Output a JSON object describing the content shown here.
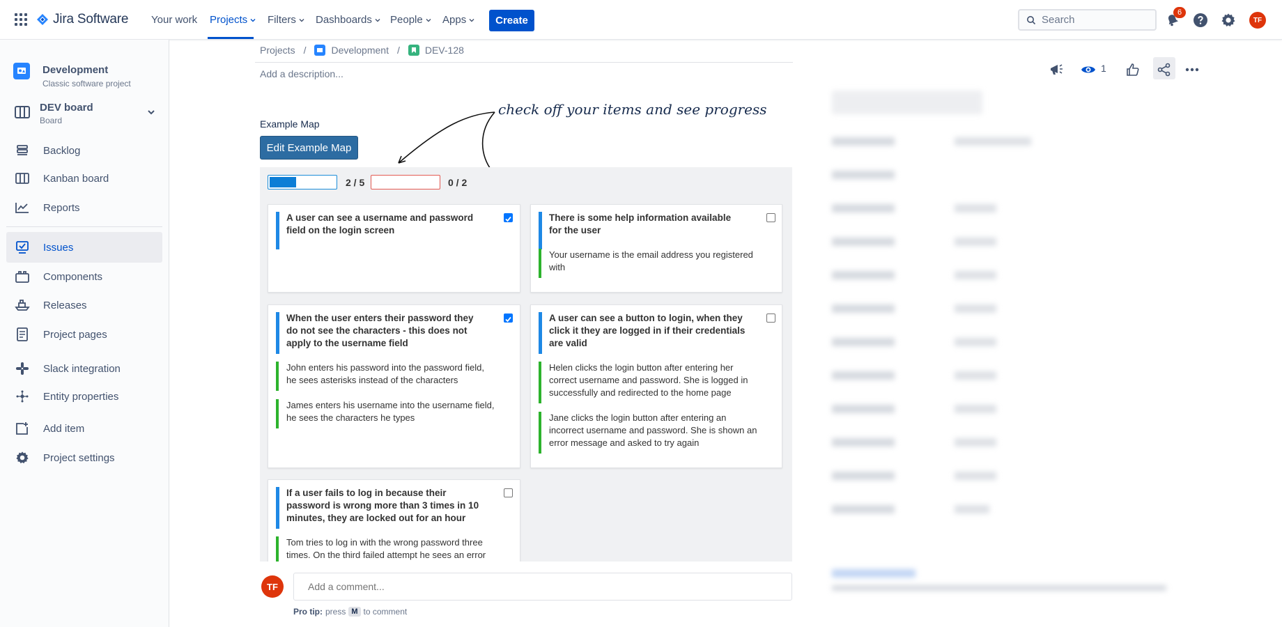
{
  "topnav": {
    "product": "Jira Software",
    "items": [
      "Your work",
      "Projects",
      "Filters",
      "Dashboards",
      "People",
      "Apps"
    ],
    "active": "Projects",
    "create_label": "Create",
    "search_placeholder": "Search",
    "notification_count": "6",
    "user_initials": "TF"
  },
  "sidebar": {
    "project_name": "Development",
    "project_type": "Classic software project",
    "board_name": "DEV board",
    "board_type": "Board",
    "items": [
      {
        "label": "Backlog",
        "icon": "backlog-icon"
      },
      {
        "label": "Kanban board",
        "icon": "kanban-icon"
      },
      {
        "label": "Reports",
        "icon": "reports-icon"
      },
      {
        "label": "Issues",
        "icon": "issues-icon"
      },
      {
        "label": "Components",
        "icon": "components-icon"
      },
      {
        "label": "Releases",
        "icon": "releases-icon"
      },
      {
        "label": "Project pages",
        "icon": "pages-icon"
      },
      {
        "label": "Slack integration",
        "icon": "slack-icon"
      },
      {
        "label": "Entity properties",
        "icon": "entity-icon"
      },
      {
        "label": "Add item",
        "icon": "add-item-icon"
      },
      {
        "label": "Project settings",
        "icon": "gear-icon"
      }
    ],
    "active_item": "Issues"
  },
  "breadcrumb": [
    "Projects",
    "Development",
    "DEV-128"
  ],
  "issue": {
    "description_placeholder": "Add a description...",
    "example_map_title": "Example Map",
    "edit_button": "Edit Example Map",
    "annotation": "check off your items and see progress"
  },
  "progress": {
    "rules_done": 2,
    "rules_total": 5,
    "rules_label": "2 / 5",
    "questions_done": 0,
    "questions_total": 2,
    "questions_label": "0 / 2"
  },
  "cards": [
    {
      "rule": "A user can see a username and password field on the login screen",
      "checked": true,
      "examples": []
    },
    {
      "rule": "There is some help information available for the user",
      "checked": false,
      "examples": [
        "Your username is the email address you registered with"
      ]
    },
    {
      "rule": "When the user enters their password they do not see the characters - this does not apply to the username field",
      "checked": true,
      "examples": [
        "John enters his password into the password field, he sees asterisks instead of the characters",
        "James enters his username into the username field, he sees the characters he types"
      ]
    },
    {
      "rule": "A user can see a button to login, when they click it they are logged in if their credentials are valid",
      "checked": false,
      "examples": [
        "Helen clicks the login button after entering her correct username and password. She is logged in successfully and redirected to the home page",
        "Jane clicks the login button after entering an incorrect username and password. She is shown an error message and asked to try again"
      ]
    },
    {
      "rule": "If a user fails to log in because their password is wrong more than 3 times in 10 minutes, they are locked out for an hour",
      "checked": false,
      "examples": [
        "Tom tries to log in with the wrong password three times. On the third failed attempt he sees an error"
      ]
    }
  ],
  "comment": {
    "avatar": "TF",
    "placeholder": "Add a comment...",
    "protip_label": "Pro tip:",
    "protip_press": "press",
    "protip_key": "M",
    "protip_suffix": "to comment"
  },
  "actions": {
    "watch_count": "1"
  },
  "colors": {
    "brand": "#0052cc",
    "rule_bar": "#1e88e5",
    "example_bar": "#2db32d",
    "progress_blue": "#0d7ed6",
    "progress_red": "#e35a52",
    "edit_button": "#2d6ca2"
  }
}
